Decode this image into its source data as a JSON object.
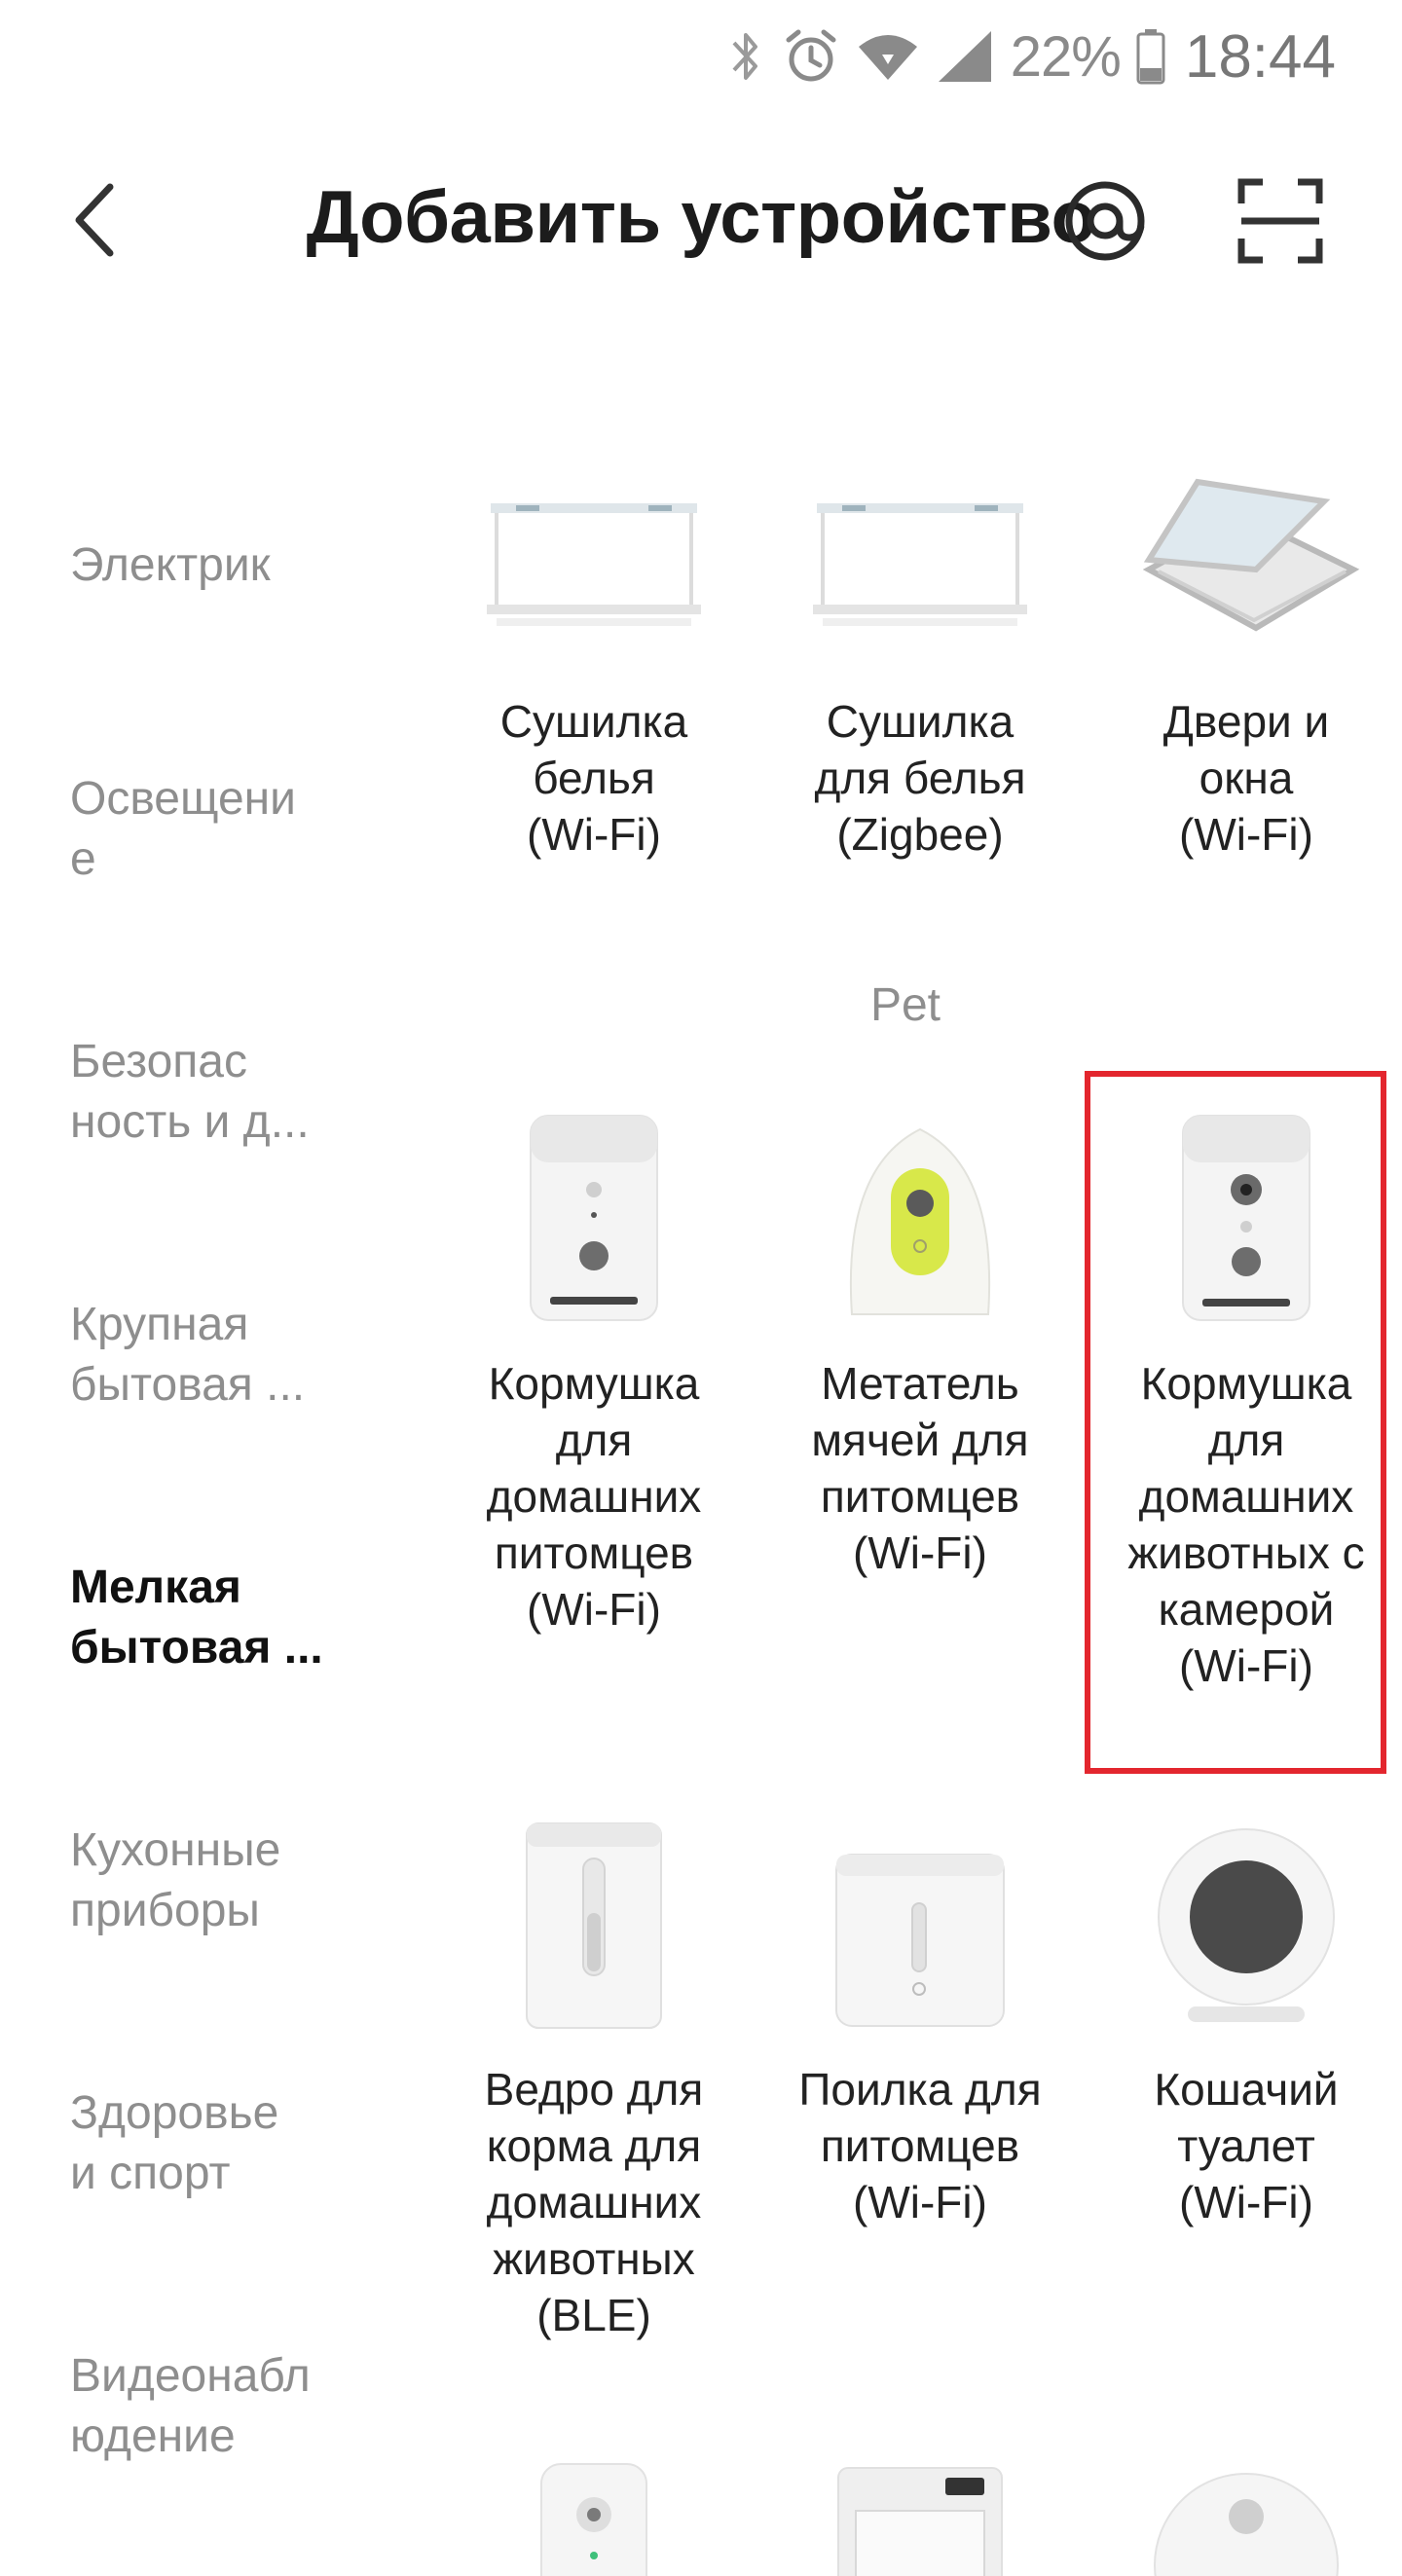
{
  "status_bar": {
    "battery_pct": "22%",
    "time": "18:44",
    "icons": [
      "bluetooth-icon",
      "alarm-icon",
      "wifi-icon",
      "signal-icon",
      "battery-icon"
    ]
  },
  "header": {
    "title": "Добавить устройство",
    "back_icon": "chevron-left-icon",
    "at_icon": "at-sign-icon",
    "scan_icon": "scan-icon"
  },
  "sidebar": {
    "items": [
      {
        "label": "Электрик",
        "active": false
      },
      {
        "label": "Освещени\nе",
        "active": false
      },
      {
        "label": "Безопас\nность и д...",
        "active": false
      },
      {
        "label": "Крупная\nбытовая ...",
        "active": false
      },
      {
        "label": "Мелкая\nбытовая ...",
        "active": true
      },
      {
        "label": "Кухонные\nприборы",
        "active": false
      },
      {
        "label": "Здоровье\nи спорт",
        "active": false
      },
      {
        "label": "Видеонабл\nюдение",
        "active": false
      }
    ]
  },
  "grid": {
    "top_row": [
      {
        "name": "Сушилка\nбелья\n(Wi-Fi)",
        "icon": "clothes-dryer-rack-icon"
      },
      {
        "name": "Сушилка\nдля белья\n(Zigbee)",
        "icon": "clothes-dryer-rack-icon"
      },
      {
        "name": "Двери и\nокна\n(Wi-Fi)",
        "icon": "window-icon"
      }
    ],
    "section_title": "Pet",
    "pet_row1": [
      {
        "name": "Кормушка\nдля\nдомашних\nпитомцев\n(Wi-Fi)",
        "icon": "pet-feeder-icon"
      },
      {
        "name": "Метатель\nмячей для\nпитомцев\n(Wi-Fi)",
        "icon": "ball-launcher-icon"
      },
      {
        "name": "Кормушка\nдля\nдомашних\nживотных с\nкамерой\n(Wi-Fi)",
        "icon": "camera-pet-feeder-icon"
      }
    ],
    "pet_row2": [
      {
        "name": "Ведро для\nкорма для\nдомашних\nживотных\n(BLE)",
        "icon": "food-bucket-icon"
      },
      {
        "name": "Поилка для\nпитомцев\n(Wi-Fi)",
        "icon": "water-fountain-icon"
      },
      {
        "name": "Кошачий\nтуалет\n(Wi-Fi)",
        "icon": "cat-litter-icon"
      }
    ]
  },
  "colors": {
    "highlight": "#e3262e",
    "accent_yellow": "#d8e84a"
  }
}
